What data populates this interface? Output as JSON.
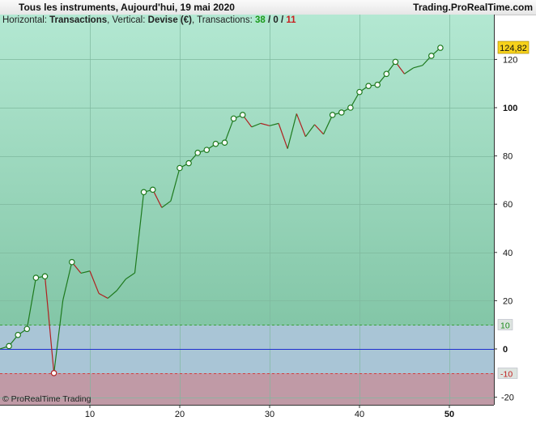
{
  "header": {
    "title": "Tous les instruments, Aujourd'hui, 19 mai 2020",
    "brand": "Trading.ProRealTime.com"
  },
  "info": {
    "horizontal_label": "Horizontal:",
    "horizontal_value": "Transactions",
    "vertical_label": "Vertical:",
    "vertical_value": "Devise (€)",
    "transactions_label": "Transactions:",
    "total": "38",
    "sep1": "/",
    "neutral": "0",
    "sep2": "/",
    "losing": "11"
  },
  "copyright": "© ProRealTime Trading",
  "colors": {
    "up_line": "#1e7a1e",
    "down_line": "#b02020",
    "zero_line": "#1e2fd0",
    "last_value_badge": "#f7d21c",
    "positive_zone": "#9ad6bc",
    "negative_zone": "#c09aa6"
  },
  "chart_data": {
    "type": "line",
    "xlabel": "",
    "ylabel": "",
    "xlim": [
      0,
      50
    ],
    "ylim": [
      -23,
      128
    ],
    "x_ticks": [
      "10",
      "20",
      "30",
      "40",
      "50"
    ],
    "y_ticks": [
      "-20",
      "0",
      "20",
      "40",
      "60",
      "80",
      "100",
      "120"
    ],
    "reference_lines": [
      {
        "value": 10,
        "label": "10",
        "style": "dashed-green"
      },
      {
        "value": 0,
        "label": "0",
        "style": "solid-blue"
      },
      {
        "value": -10,
        "label": "-10",
        "style": "dashed-red"
      }
    ],
    "last_value": "124,82",
    "series": [
      {
        "x": [
          0,
          1,
          2,
          3,
          4,
          5,
          6,
          7,
          8,
          9,
          10,
          11,
          12,
          13,
          14,
          15,
          16,
          17,
          18,
          19,
          20,
          21,
          22,
          23,
          24,
          25,
          26,
          27,
          28,
          29,
          30,
          31,
          32,
          33,
          34,
          35,
          36,
          37,
          38,
          39,
          40,
          41,
          42,
          43,
          44,
          45,
          46,
          47,
          48,
          49
        ],
        "y": [
          0,
          1.2,
          5.8,
          8.3,
          29.5,
          30.1,
          -10,
          20.2,
          36,
          31.4,
          32.3,
          23,
          21,
          24.2,
          29,
          31.5,
          65,
          66,
          58.6,
          61.3,
          75,
          77,
          81.3,
          82.5,
          85,
          85.5,
          95.5,
          97,
          92,
          93.5,
          92.5,
          93.5,
          83,
          97.5,
          88,
          93,
          89,
          97,
          98,
          100,
          106.5,
          109,
          109.5,
          114,
          119,
          114,
          116.5,
          117.5,
          121.5,
          124.82
        ],
        "new_high_markers": [
          1,
          2,
          3,
          4,
          5,
          6,
          8,
          16,
          17,
          20,
          21,
          22,
          23,
          24,
          25,
          26,
          27,
          37,
          38,
          39,
          40,
          41,
          42,
          43,
          44,
          48,
          49
        ]
      }
    ]
  }
}
